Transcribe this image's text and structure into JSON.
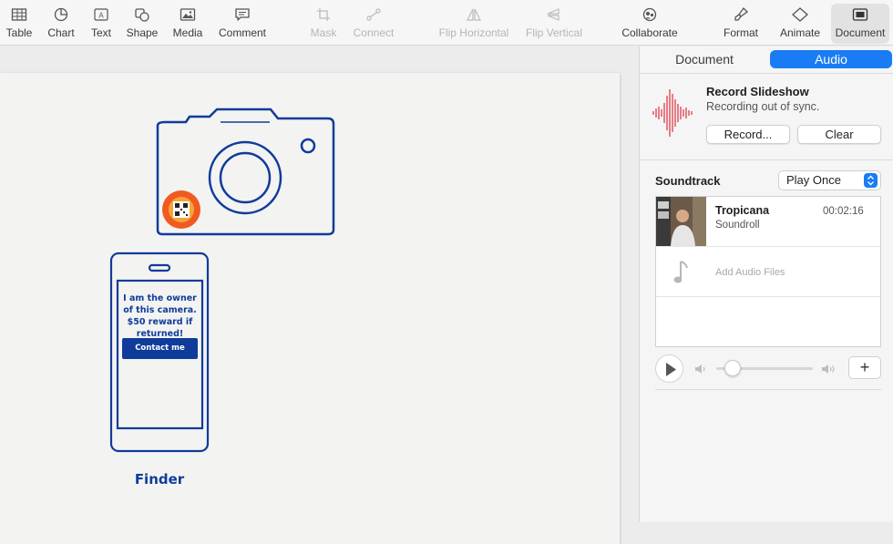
{
  "toolbar": {
    "items": [
      {
        "label": "Table",
        "icon": "table-icon",
        "enabled": true
      },
      {
        "label": "Chart",
        "icon": "chart-icon",
        "enabled": true
      },
      {
        "label": "Text",
        "icon": "text-icon",
        "enabled": true
      },
      {
        "label": "Shape",
        "icon": "shape-icon",
        "enabled": true
      },
      {
        "label": "Media",
        "icon": "media-icon",
        "enabled": true
      },
      {
        "label": "Comment",
        "icon": "comment-icon",
        "enabled": true
      },
      {
        "label": "Mask",
        "icon": "crop-icon",
        "enabled": false
      },
      {
        "label": "Connect",
        "icon": "connect-icon",
        "enabled": false
      },
      {
        "label": "Flip Horizontal",
        "icon": "flip-horizontal-icon",
        "enabled": false
      },
      {
        "label": "Flip Vertical",
        "icon": "flip-vertical-icon",
        "enabled": false
      },
      {
        "label": "Collaborate",
        "icon": "collaborate-icon",
        "enabled": true
      },
      {
        "label": "Format",
        "icon": "paintbrush-icon",
        "enabled": true
      },
      {
        "label": "Animate",
        "icon": "diamond-icon",
        "enabled": true
      },
      {
        "label": "Document",
        "icon": "document-icon",
        "enabled": true,
        "active": true
      }
    ]
  },
  "slide": {
    "phone_message": "I am the owner of this camera. $50 reward if returned!",
    "contact_button": "Contact me",
    "finder_label": "Finder",
    "ink_color": "#0f3c9a",
    "qr_badge_color": "#f05a22"
  },
  "inspector": {
    "tabs": [
      "Document",
      "Audio"
    ],
    "active_tab": "Audio",
    "record_title": "Record Slideshow",
    "record_status": "Recording out of sync.",
    "record_button": "Record...",
    "clear_button": "Clear",
    "soundtrack_label": "Soundtrack",
    "soundtrack_mode": "Play Once",
    "track": {
      "name": "Tropicana",
      "artist": "Soundroll",
      "duration": "00:02:16"
    },
    "add_audio_label": "Add Audio Files",
    "volume_level": 0.1,
    "add_button": "+",
    "accent_color": "#1a7cf5",
    "waveform_color": "#e23b4a"
  }
}
